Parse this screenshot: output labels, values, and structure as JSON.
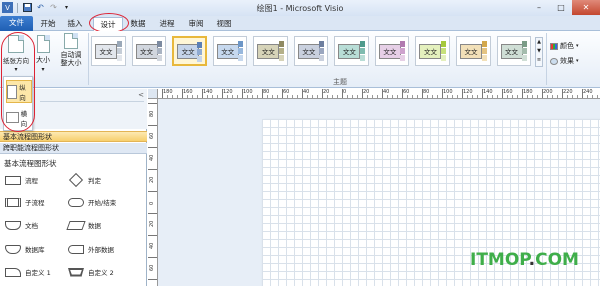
{
  "window": {
    "title": "绘图1 - Microsoft Visio",
    "quick_access": [
      "save-icon",
      "undo-icon",
      "redo-icon",
      "customize-icon"
    ]
  },
  "tabs": [
    {
      "label": "文件",
      "kind": "file"
    },
    {
      "label": "开始"
    },
    {
      "label": "插入"
    },
    {
      "label": "设计",
      "active": true
    },
    {
      "label": "数据"
    },
    {
      "label": "进程"
    },
    {
      "label": "审阅"
    },
    {
      "label": "视图"
    }
  ],
  "ribbon": {
    "page_setup": {
      "orientation_label": "纸张方向",
      "size_label": "大小",
      "auto_size_label": "自动调整大小"
    },
    "themes": {
      "group_label": "主题",
      "thumb_text": "文文",
      "items": [
        {
          "bars": [
            "#9aa8b8",
            "#c5cdd7",
            "#e2e6ec"
          ]
        },
        {
          "bars": [
            "#7c8aa0",
            "#a9b3c2",
            "#d1d6de"
          ]
        },
        {
          "bars": [
            "#5b7fb6",
            "#8faad2",
            "#c5d4ea"
          ],
          "selected": true
        },
        {
          "bars": [
            "#6c96c7",
            "#98b8dd",
            "#c6d8ee"
          ]
        },
        {
          "bars": [
            "#8f8a63",
            "#b4b089",
            "#d6d3b8"
          ]
        },
        {
          "bars": [
            "#6e7f9f",
            "#9aa6bf",
            "#c9d0de"
          ]
        },
        {
          "bars": [
            "#4f9b8d",
            "#7fbcb0",
            "#b8ddd6"
          ]
        },
        {
          "bars": [
            "#b07ab0",
            "#cda2cd",
            "#e6cfe6"
          ]
        },
        {
          "bars": [
            "#a6c93c",
            "#c7e07a",
            "#e4f0bd"
          ]
        },
        {
          "bars": [
            "#d3a84c",
            "#e4c482",
            "#f2e0b8"
          ]
        },
        {
          "bars": [
            "#7b9c87",
            "#a4bcad",
            "#cfded5"
          ]
        }
      ]
    },
    "options": [
      {
        "label": "颜色"
      },
      {
        "label": "效果"
      }
    ]
  },
  "orientation_menu": {
    "items": [
      {
        "label": "纵向",
        "selected": true
      },
      {
        "label": "横向"
      }
    ]
  },
  "shapes_panel": {
    "stencils": [
      {
        "label": "基本流程图形状",
        "active": true
      },
      {
        "label": "跨职能流程图形状"
      }
    ],
    "section_title": "基本流程图形状",
    "shapes": [
      {
        "label": "流程",
        "icon": "process"
      },
      {
        "label": "判定",
        "icon": "decision"
      },
      {
        "label": "子流程",
        "icon": "subprocess"
      },
      {
        "label": "开始/结束",
        "icon": "terminator"
      },
      {
        "label": "文档",
        "icon": "document"
      },
      {
        "label": "数据",
        "icon": "data"
      },
      {
        "label": "数据库",
        "icon": "database"
      },
      {
        "label": "外部数据",
        "icon": "external-data"
      },
      {
        "label": "自定义 1",
        "icon": "custom-1"
      },
      {
        "label": "自定义 2",
        "icon": "custom-2"
      }
    ]
  },
  "ruler": {
    "h_labels": [
      "180",
      "160",
      "140",
      "120",
      "100",
      "80",
      "60",
      "40",
      "20",
      "0",
      "20",
      "40",
      "60",
      "80",
      "100",
      "120",
      "140",
      "160",
      "180",
      "200",
      "220",
      "240",
      "260"
    ],
    "v_labels": [
      "80",
      "60",
      "40",
      "20",
      "0",
      "20",
      "40",
      "60",
      "80"
    ]
  },
  "watermark": {
    "text_left": "ITMOP",
    "dot": ".",
    "text_right": "COM"
  }
}
